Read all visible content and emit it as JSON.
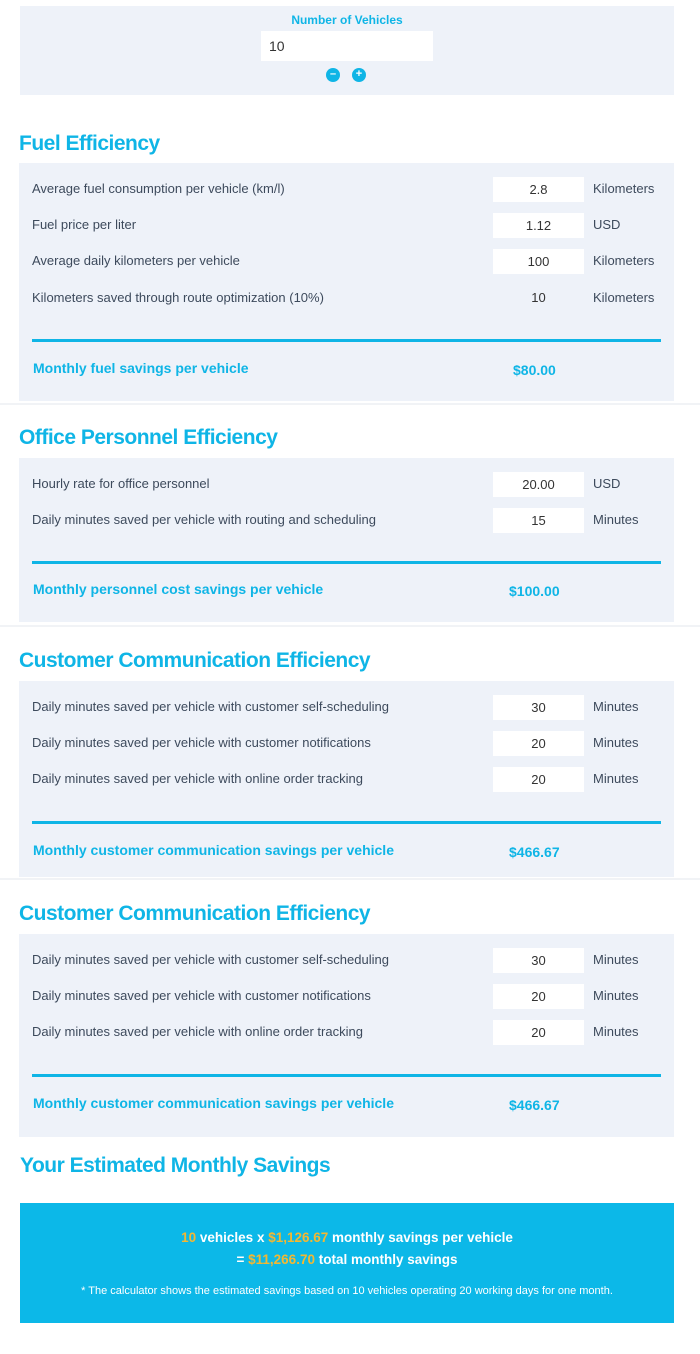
{
  "vehicles": {
    "label": "Number of Vehicles",
    "value": "10",
    "minus": "–",
    "plus": "+"
  },
  "fuel": {
    "title": "Fuel Efficiency",
    "rows": [
      {
        "label": "Average fuel consumption per vehicle (km/l)",
        "value": "2.8",
        "unit": "Kilometers"
      },
      {
        "label": "Fuel price per liter",
        "value": "1.12",
        "unit": "USD"
      },
      {
        "label": "Average daily kilometers per vehicle",
        "value": "100",
        "unit": "Kilometers"
      },
      {
        "label": "Kilometers saved through route optimization (10%)",
        "value": "10",
        "unit": "Kilometers"
      }
    ],
    "summary_label": "Monthly fuel savings per vehicle",
    "summary_value": "$80.00"
  },
  "personnel": {
    "title": "Office Personnel Efficiency",
    "rows": [
      {
        "label": "Hourly rate for office personnel",
        "value": "20.00",
        "unit": "USD"
      },
      {
        "label": "Daily minutes saved per vehicle with routing and scheduling",
        "value": "15",
        "unit": "Minutes"
      }
    ],
    "summary_label": "Monthly personnel cost savings per vehicle",
    "summary_value": "$100.00"
  },
  "communication1": {
    "title": "Customer Communication Efficiency",
    "rows": [
      {
        "label": "Daily minutes saved per vehicle with customer self-scheduling",
        "value": "30",
        "unit": "Minutes"
      },
      {
        "label": "Daily minutes saved per vehicle with customer notifications",
        "value": "20",
        "unit": "Minutes"
      },
      {
        "label": "Daily minutes saved per vehicle with online order tracking",
        "value": "20",
        "unit": "Minutes"
      }
    ],
    "summary_label": "Monthly customer communication savings per vehicle",
    "summary_value": "$466.67"
  },
  "communication2": {
    "title": "Customer Communication Efficiency",
    "rows": [
      {
        "label": "Daily minutes saved per vehicle with customer self-scheduling",
        "value": "30",
        "unit": "Minutes"
      },
      {
        "label": "Daily minutes saved per vehicle with customer notifications",
        "value": "20",
        "unit": "Minutes"
      },
      {
        "label": "Daily minutes saved per vehicle with online order tracking",
        "value": "20",
        "unit": "Minutes"
      }
    ],
    "summary_label": "Monthly customer communication savings per vehicle",
    "summary_value": "$466.67"
  },
  "result": {
    "title": "Your Estimated Monthly Savings",
    "vehicles": "10",
    "vehicles_text": " vehicles x ",
    "per_vehicle": "$1,126.67",
    "per_vehicle_text": " monthly savings per vehicle",
    "equals": "= ",
    "total": "$11,266.70",
    "total_text": " total monthly savings",
    "note": "* The calculator shows the estimated savings based on 10 vehicles operating 20 working days for one month."
  },
  "colors": {
    "accent": "#0fb5e6",
    "highlight": "#f5b731",
    "panel": "#eef2f9"
  }
}
